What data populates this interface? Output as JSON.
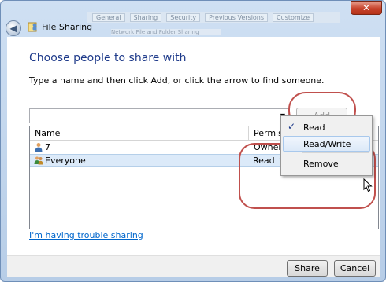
{
  "window": {
    "title": "File Sharing",
    "background_tabs": [
      "General",
      "Sharing",
      "Security",
      "Previous Versions",
      "Customize"
    ],
    "background_subtitle": "Network File and Folder Sharing"
  },
  "main": {
    "heading": "Choose people to share with",
    "instructions": "Type a name and then click Add, or click the arrow to find someone.",
    "name_input": {
      "value": "",
      "placeholder": ""
    },
    "add_label": "Add"
  },
  "list": {
    "headers": {
      "name": "Name",
      "permission": "Permission Level"
    },
    "rows": [
      {
        "name": "7",
        "permission": "Owner",
        "icon": "user-icon"
      },
      {
        "name": "Everyone",
        "permission": "Read",
        "icon": "group-icon"
      }
    ]
  },
  "permission_menu": {
    "items": [
      {
        "label": "Read",
        "checked": true
      },
      {
        "label": "Read/Write",
        "checked": false
      },
      {
        "label": "Remove",
        "checked": false
      }
    ]
  },
  "trouble_link": "I'm having trouble sharing",
  "footer": {
    "share_label": "Share",
    "cancel_label": "Cancel"
  },
  "colors": {
    "heading": "#1e3a8a",
    "link": "#0066cc",
    "annotation": "#c0504d",
    "selected_row": "#dceaf9"
  }
}
